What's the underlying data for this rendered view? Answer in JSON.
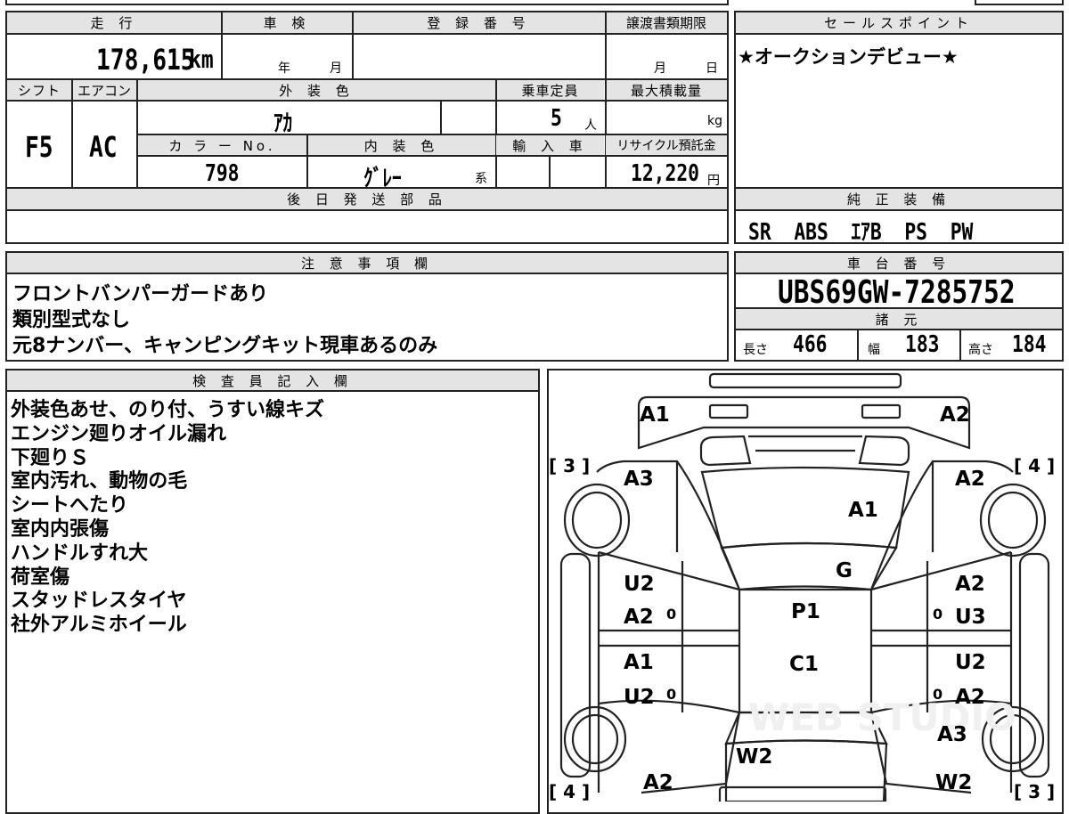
{
  "headers": {
    "mileage": "走 行",
    "shaken": "車 検",
    "registration": "登 録 番 号",
    "transfer_deadline": "譲渡書類期限",
    "sales_point": "セールスポイント",
    "shift": "シフト",
    "aircon": "エアコン",
    "exterior_color": "外 装 色",
    "capacity": "乗車定員",
    "max_load": "最大積載量",
    "color_no": "カ ラ ー No.",
    "interior_color": "内 装 色",
    "import": "輸 入 車",
    "recycle": "リサイクル預託金",
    "later_parts": "後 日 発 送 部 品",
    "genuine_equipment": "純 正 装 備",
    "notes": "注 意 事 項 欄",
    "chassis_no": "車 台 番 号",
    "specs": "諸 元",
    "inspector": "検 査 員 記 入 欄"
  },
  "mileage": {
    "value": "178,615",
    "unit": "km"
  },
  "shaken": {
    "year_label": "年",
    "month_label": "月"
  },
  "transfer_deadline": {
    "month_label": "月",
    "day_label": "日"
  },
  "shift": "F5",
  "aircon": "AC",
  "exterior_color": "ｱｶ",
  "capacity": {
    "value": "5",
    "unit": "人"
  },
  "max_load": {
    "unit": "kg"
  },
  "color_no": "798",
  "interior_color": {
    "value": "ｸﾞﾚｰ",
    "suffix": "系"
  },
  "recycle": {
    "value": "12,220",
    "unit": "円"
  },
  "sales_point": "★オークションデビュー★",
  "genuine_equipment": "SR  ABS  ｴｱB  PS  PW",
  "chassis_no": "UBS69GW-7285752",
  "specs": {
    "length_label": "長さ",
    "length": "466",
    "width_label": "幅",
    "width": "183",
    "height_label": "高さ",
    "height": "184"
  },
  "notes": [
    "フロントバンパーガードあり",
    "類別型式なし",
    "元8ナンバー、キャンピングキット現車あるのみ"
  ],
  "inspector_notes": [
    "外装色あせ、のり付、うすい線キズ",
    "エンジン廻りオイル漏れ",
    "下廻りＳ",
    "室内汚れ、動物の毛",
    "シートへたり",
    "室内内張傷",
    "ハンドルすれ大",
    "荷室傷",
    "スタッドレスタイヤ",
    "社外アルミホイール"
  ],
  "diagram": {
    "labels": [
      {
        "text": "A1"
      },
      {
        "text": "A2"
      },
      {
        "text": "A3"
      },
      {
        "text": "A2"
      },
      {
        "text": "A1"
      },
      {
        "text": "G"
      },
      {
        "text": "U2"
      },
      {
        "text": "A2"
      },
      {
        "text": "P1"
      },
      {
        "text": "A2"
      },
      {
        "text": "U3"
      },
      {
        "text": "A1"
      },
      {
        "text": "C1"
      },
      {
        "text": "U2"
      },
      {
        "text": "U2"
      },
      {
        "text": "A2"
      },
      {
        "text": "A3"
      },
      {
        "text": "W2"
      },
      {
        "text": "A2"
      },
      {
        "text": "W2"
      }
    ],
    "tire_marks": [
      {
        "text": "[ 3 ]"
      },
      {
        "text": "[ 4 ]"
      },
      {
        "text": "[ 4 ]"
      },
      {
        "text": "[ 3 ]"
      }
    ],
    "zeros": [
      "0",
      "0",
      "0",
      "0"
    ],
    "watermark": "WEB STUDIO"
  }
}
